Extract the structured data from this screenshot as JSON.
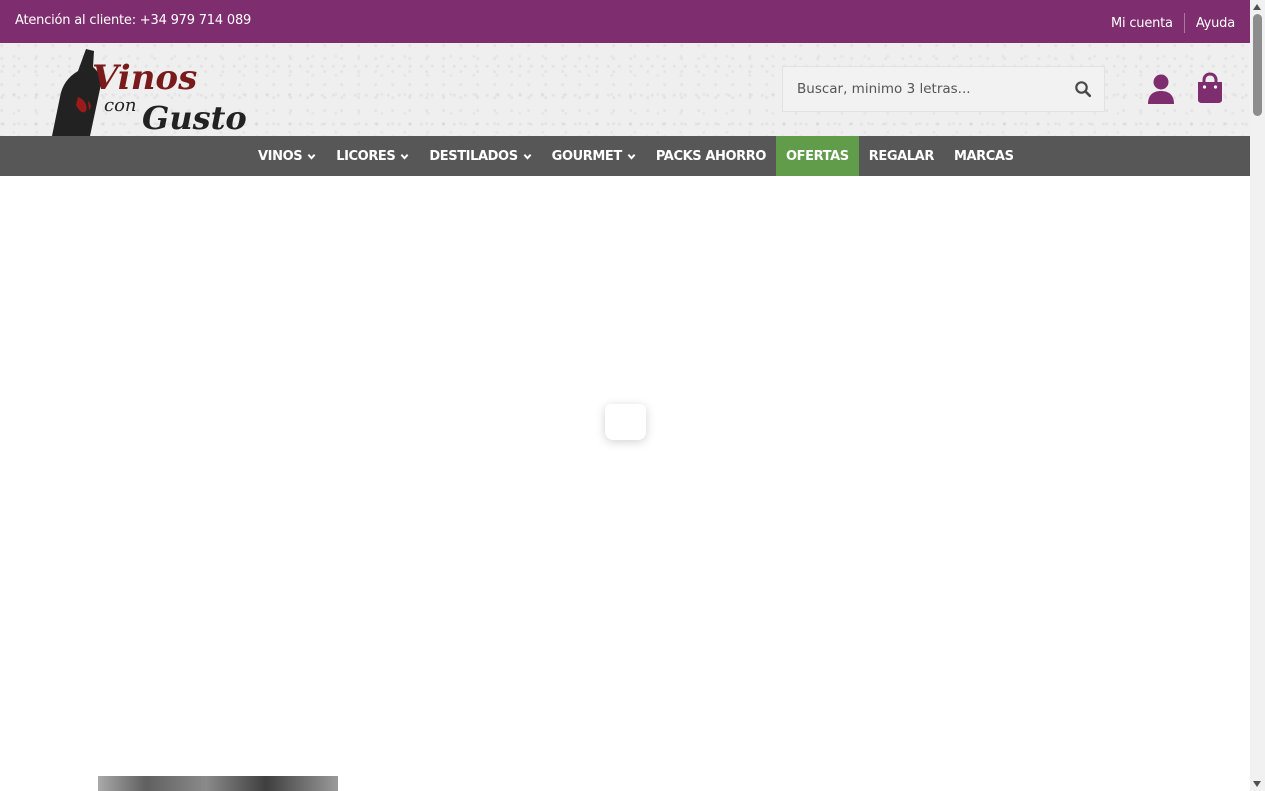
{
  "topbar": {
    "support_text": "Atención al cliente: +34 979 714 089",
    "my_account": "Mi cuenta",
    "help": "Ayuda",
    "bg_color": "#7e2d6e"
  },
  "header": {
    "logo_line1": "Vinos",
    "logo_line2": "con",
    "logo_line3": "Gusto",
    "search": {
      "placeholder": "Buscar, minimo 3 letras...",
      "value": ""
    },
    "icons": {
      "search": "search-icon",
      "user": "user-icon",
      "cart": "shopping-bag-icon"
    },
    "accent_color": "#7e2d6e"
  },
  "nav": {
    "items": [
      {
        "label": "VINOS",
        "dropdown": true
      },
      {
        "label": "LICORES",
        "dropdown": true
      },
      {
        "label": "DESTILADOS",
        "dropdown": true
      },
      {
        "label": "GOURMET",
        "dropdown": true
      },
      {
        "label": "PACKS AHORRO",
        "dropdown": false
      },
      {
        "label": "OFERTAS",
        "dropdown": false,
        "highlight_color": "#609c4a"
      },
      {
        "label": "REGALAR",
        "dropdown": false
      },
      {
        "label": "MARCAS",
        "dropdown": false
      }
    ],
    "bg_color": "#575757"
  }
}
